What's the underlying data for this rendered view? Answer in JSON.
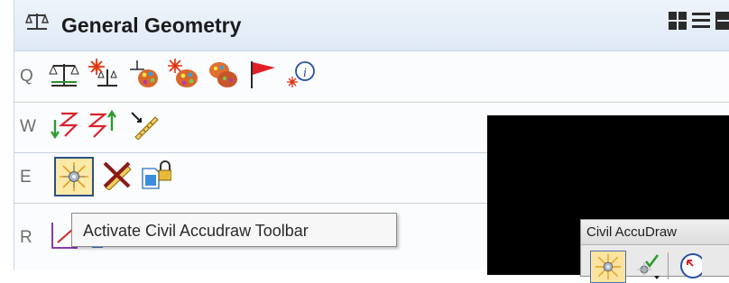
{
  "panel": {
    "title": "General Geometry",
    "header_icons": [
      "geometry-scale-icon",
      "grid-view-icon",
      "list-view-icon",
      "compact-view-icon",
      "collapse-icon"
    ],
    "rows": [
      {
        "key": "Q",
        "tools": [
          "element-information-icon",
          "element-update-icon",
          "element-template-icon",
          "transient-template-icon",
          "palette-icon",
          "flag-icon",
          "info-icon"
        ]
      },
      {
        "key": "W",
        "tools": [
          "horizontal-geometry-icon",
          "vertical-geometry-icon",
          "measure-ruler-icon"
        ]
      },
      {
        "key": "E",
        "tools": [
          "civil-accudraw-icon",
          "delete-ruler-icon",
          "lock-file-icon"
        ]
      },
      {
        "key": "R",
        "tools": [
          "partial-tool-1-icon",
          "partial-tool-2-icon",
          "partial-tool-3-icon"
        ]
      }
    ]
  },
  "tooltip": {
    "text": "Activate Civil Accudraw Toolbar"
  },
  "accudraw_toolbar": {
    "title": "Civil AccuDraw",
    "tools": [
      "accudraw-target-icon",
      "accudraw-check-dropdown-icon",
      "accudraw-circle-icon"
    ]
  },
  "colors": {
    "header_bg": "#dfe9f6",
    "selected_tool_border": "#2f4f86",
    "selected_tool_bg": "#fbe9a8",
    "dark_bg": "#000000"
  }
}
